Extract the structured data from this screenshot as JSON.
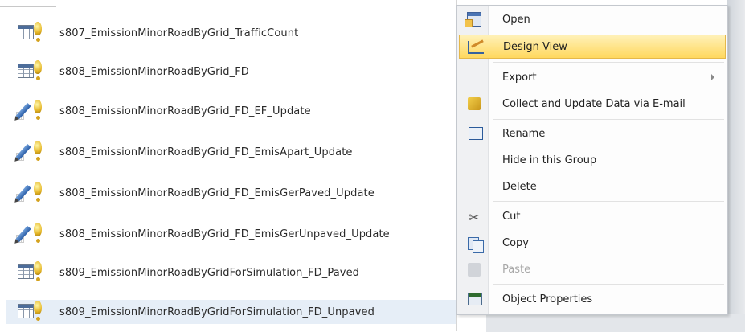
{
  "objects": [
    {
      "type": "table-query",
      "name": "s807_EmissionMinorRoadByGrid_TrafficCount",
      "icon": "table-query-icon"
    },
    {
      "type": "table-query",
      "name": "s808_EmissionMinorRoadByGrid_FD",
      "icon": "table-query-icon"
    },
    {
      "type": "update-query",
      "name": "s808_EmissionMinorRoadByGrid_FD_EF_Update",
      "icon": "update-query-icon"
    },
    {
      "type": "update-query",
      "name": "s808_EmissionMinorRoadByGrid_FD_EmisApart_Update",
      "icon": "update-query-icon"
    },
    {
      "type": "update-query",
      "name": "s808_EmissionMinorRoadByGrid_FD_EmisGerPaved_Update",
      "icon": "update-query-icon"
    },
    {
      "type": "update-query",
      "name": "s808_EmissionMinorRoadByGrid_FD_EmisGerUnpaved_Update",
      "icon": "update-query-icon"
    },
    {
      "type": "table-query",
      "name": "s809_EmissionMinorRoadByGridForSimulation_FD_Paved",
      "icon": "table-query-icon"
    },
    {
      "type": "table-query",
      "name": "s809_EmissionMinorRoadByGridForSimulation_FD_Unpaved",
      "icon": "table-query-icon",
      "selected": true
    }
  ],
  "context_menu": {
    "items": [
      {
        "label": "Open",
        "icon": "open-icon"
      },
      {
        "label": "Design View",
        "icon": "design-view-icon",
        "highlighted": true
      },
      {
        "label": "Export",
        "icon": "",
        "submenu": true
      },
      {
        "label": "Collect and Update Data via E-mail",
        "icon": "collect-data-icon"
      },
      {
        "label": "Rename",
        "icon": "rename-icon"
      },
      {
        "label": "Hide in this Group",
        "icon": ""
      },
      {
        "label": "Delete",
        "icon": ""
      },
      {
        "label": "Cut",
        "icon": "cut-icon"
      },
      {
        "label": "Copy",
        "icon": "copy-icon"
      },
      {
        "label": "Paste",
        "icon": "paste-icon",
        "disabled": true
      },
      {
        "label": "Object Properties",
        "icon": "properties-icon"
      }
    ]
  },
  "colors": {
    "highlight_start": "#fff1b8",
    "highlight_end": "#ffd85e",
    "selection": "#e6eef7",
    "disabled_text": "#a8a8a8"
  }
}
